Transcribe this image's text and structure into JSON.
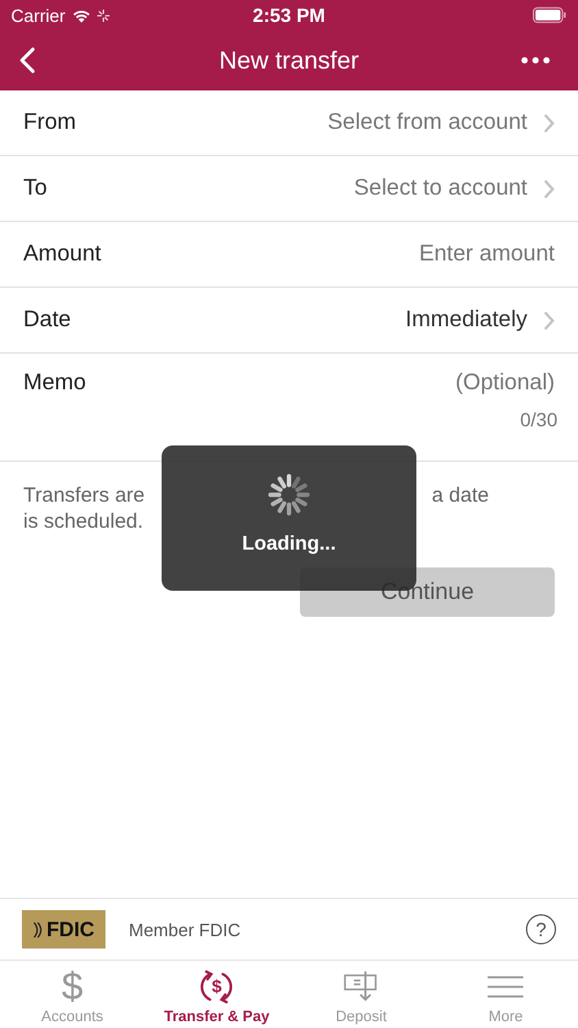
{
  "status_bar": {
    "carrier": "Carrier",
    "time": "2:53 PM"
  },
  "nav": {
    "title": "New transfer"
  },
  "form_rows": [
    {
      "label": "From",
      "placeholder": "Select from account",
      "kind": "picker"
    },
    {
      "label": "To",
      "placeholder": "Select to account",
      "kind": "picker"
    },
    {
      "label": "Amount",
      "placeholder": "Enter amount",
      "kind": "input"
    },
    {
      "label": "Date",
      "value": "Immediately",
      "kind": "picker"
    },
    {
      "label": "Memo",
      "placeholder": "(Optional)",
      "kind": "memo",
      "counter": "0/30"
    }
  ],
  "note_line_1": [
    "Transfers are",
    "a date"
  ],
  "note_line_2": "is scheduled.",
  "continue_button": {
    "label": "Continue",
    "disabled": true
  },
  "loading": {
    "label": "Loading..."
  },
  "footer": {
    "logo": "FDIC",
    "text": "Member FDIC",
    "help": "?"
  },
  "tabs": [
    {
      "label": "Accounts",
      "icon": "$",
      "selected": false
    },
    {
      "label": "Transfer & Pay",
      "icon": "$",
      "selected": true
    },
    {
      "label": "Deposit",
      "selected": false
    },
    {
      "label": "More",
      "selected": false
    }
  ]
}
